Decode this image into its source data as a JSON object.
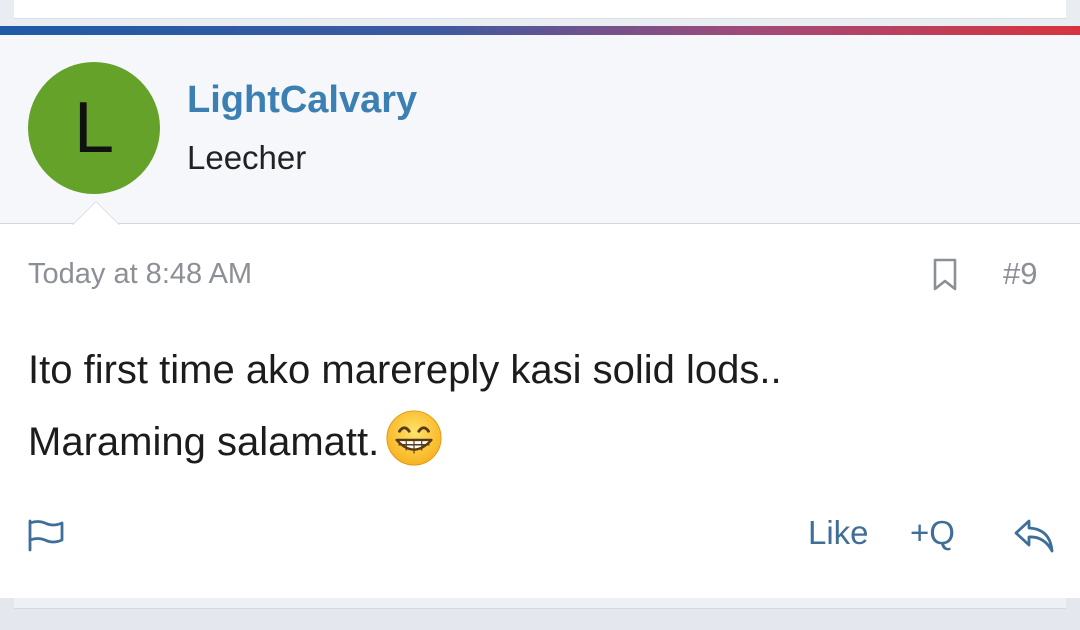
{
  "post": {
    "author": {
      "avatar_letter": "L",
      "avatar_color": "#65a22a",
      "username": "LightCalvary",
      "user_title": "Leecher"
    },
    "timestamp": "Today at 8:48 AM",
    "post_number": "#9",
    "message": {
      "line1": "Ito first time ako marereply kasi solid lods..",
      "line2": "Maraming salamatt.",
      "emoji": "grinning-face-with-smiling-eyes-icon"
    },
    "actions": {
      "like_label": "Like",
      "multiquote_label": "+Q",
      "report_icon": "flag-icon",
      "reply_icon": "reply-arrow-icon",
      "bookmark_icon": "bookmark-icon"
    },
    "colors": {
      "accent_start": "#1f5aa6",
      "accent_end": "#d6343e",
      "username": "#3b7fb3",
      "action_text": "#3f6f99",
      "meta_text": "#8c8f95"
    }
  }
}
